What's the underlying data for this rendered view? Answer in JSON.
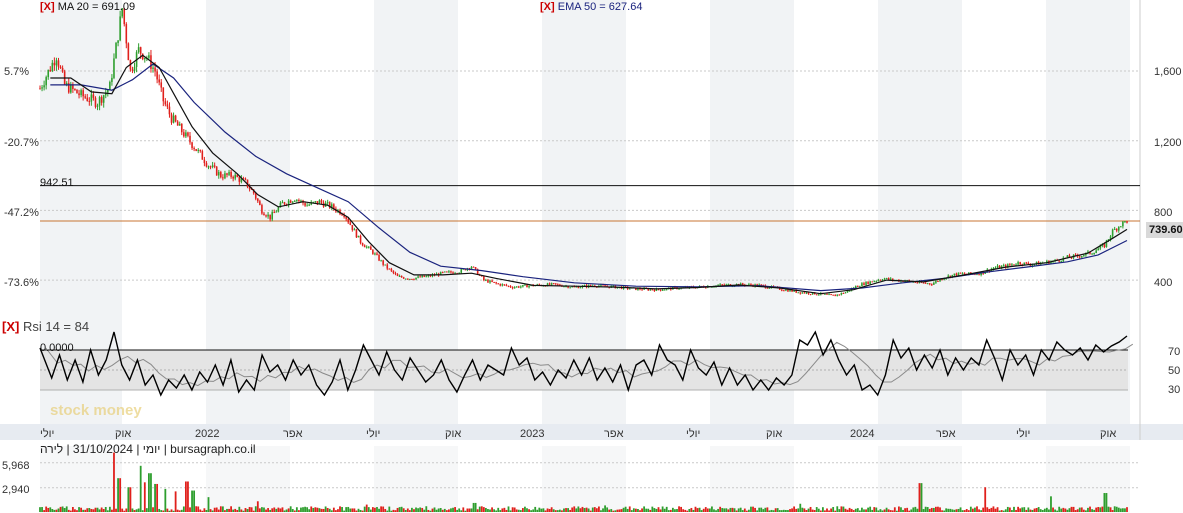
{
  "legends": {
    "ma_marker": "[X]",
    "ma_text": "MA 20 = 691.09",
    "ema_marker": "[X]",
    "ema_text": "EMA 50 = 627.64",
    "rsi_marker": "[X]",
    "rsi_text": "Rsi 14 = 84"
  },
  "source_line": "יומי | 31/10/2024 | לירה | bursagraph.co.il",
  "watermark": "stock money",
  "last_price_tag": "739.60",
  "colors": {
    "up": "#2e9e2e",
    "down": "#e0201c",
    "ma": "#111111",
    "ema": "#1a237e",
    "hline": "#c87533"
  },
  "chart_data": [
    {
      "type": "candlestick",
      "x_labels": [
        "יולי",
        "אוק",
        "2022",
        "אפר",
        "יולי",
        "אוק",
        "2023",
        "אפר",
        "יולי",
        "אוק",
        "2024",
        "אפר",
        "יולי",
        "אוק"
      ],
      "y_right_ticks": [
        "1,600",
        "1,200",
        "800",
        "400"
      ],
      "y_right_values": [
        1600,
        1200,
        800,
        400
      ],
      "y_left_ticks": [
        "5.7%",
        "-20.7%",
        "-47.2%",
        "-73.6%"
      ],
      "y_left_values": [
        1600,
        1200,
        800,
        400
      ],
      "ylim": [
        200,
        1950
      ],
      "reference_line": {
        "label": "942.51",
        "value": 942.51
      },
      "last_price_line": 739.6,
      "close_path": [
        [
          0,
          1500
        ],
        [
          8,
          1690
        ],
        [
          12,
          1520
        ],
        [
          20,
          1460
        ],
        [
          28,
          1420
        ],
        [
          34,
          1510
        ],
        [
          40,
          1960
        ],
        [
          44,
          1600
        ],
        [
          48,
          1720
        ],
        [
          52,
          1680
        ],
        [
          56,
          1600
        ],
        [
          60,
          1430
        ],
        [
          64,
          1330
        ],
        [
          70,
          1240
        ],
        [
          76,
          1150
        ],
        [
          82,
          1060
        ],
        [
          88,
          1000
        ],
        [
          94,
          1000
        ],
        [
          100,
          960
        ],
        [
          104,
          900
        ],
        [
          108,
          800
        ],
        [
          112,
          760
        ],
        [
          118,
          840
        ],
        [
          124,
          870
        ],
        [
          130,
          830
        ],
        [
          136,
          850
        ],
        [
          142,
          820
        ],
        [
          148,
          780
        ],
        [
          152,
          700
        ],
        [
          156,
          620
        ],
        [
          162,
          560
        ],
        [
          168,
          480
        ],
        [
          174,
          420
        ],
        [
          180,
          410
        ],
        [
          188,
          420
        ],
        [
          196,
          440
        ],
        [
          204,
          450
        ],
        [
          210,
          480
        ],
        [
          216,
          400
        ],
        [
          222,
          380
        ],
        [
          230,
          360
        ],
        [
          240,
          370
        ],
        [
          250,
          375
        ],
        [
          260,
          360
        ],
        [
          270,
          370
        ],
        [
          280,
          360
        ],
        [
          290,
          350
        ],
        [
          300,
          345
        ],
        [
          310,
          355
        ],
        [
          320,
          360
        ],
        [
          330,
          370
        ],
        [
          340,
          375
        ],
        [
          350,
          370
        ],
        [
          360,
          350
        ],
        [
          370,
          330
        ],
        [
          380,
          320
        ],
        [
          386,
          310
        ],
        [
          392,
          330
        ],
        [
          398,
          370
        ],
        [
          404,
          390
        ],
        [
          410,
          410
        ],
        [
          416,
          400
        ],
        [
          422,
          395
        ],
        [
          428,
          385
        ],
        [
          434,
          380
        ],
        [
          440,
          415
        ],
        [
          446,
          435
        ],
        [
          452,
          435
        ],
        [
          458,
          440
        ],
        [
          464,
          470
        ],
        [
          470,
          480
        ],
        [
          476,
          500
        ],
        [
          482,
          490
        ],
        [
          488,
          500
        ],
        [
          494,
          510
        ],
        [
          500,
          530
        ],
        [
          506,
          540
        ],
        [
          512,
          560
        ],
        [
          518,
          600
        ],
        [
          522,
          680
        ],
        [
          526,
          720
        ],
        [
          529,
          739.6
        ]
      ],
      "ma_path": [
        [
          5,
          1560
        ],
        [
          15,
          1560
        ],
        [
          25,
          1480
        ],
        [
          35,
          1470
        ],
        [
          42,
          1620
        ],
        [
          50,
          1690
        ],
        [
          58,
          1620
        ],
        [
          66,
          1450
        ],
        [
          74,
          1280
        ],
        [
          84,
          1130
        ],
        [
          96,
          1010
        ],
        [
          106,
          890
        ],
        [
          116,
          820
        ],
        [
          128,
          850
        ],
        [
          140,
          830
        ],
        [
          150,
          760
        ],
        [
          160,
          620
        ],
        [
          170,
          500
        ],
        [
          182,
          430
        ],
        [
          196,
          430
        ],
        [
          210,
          440
        ],
        [
          222,
          410
        ],
        [
          240,
          370
        ],
        [
          260,
          365
        ],
        [
          280,
          360
        ],
        [
          300,
          350
        ],
        [
          320,
          358
        ],
        [
          340,
          372
        ],
        [
          360,
          355
        ],
        [
          380,
          322
        ],
        [
          396,
          345
        ],
        [
          412,
          400
        ],
        [
          430,
          390
        ],
        [
          450,
          430
        ],
        [
          470,
          475
        ],
        [
          490,
          500
        ],
        [
          510,
          555
        ],
        [
          522,
          640
        ],
        [
          529,
          691.09
        ]
      ],
      "ema_path": [
        [
          5,
          1520
        ],
        [
          20,
          1520
        ],
        [
          35,
          1490
        ],
        [
          45,
          1550
        ],
        [
          55,
          1640
        ],
        [
          65,
          1560
        ],
        [
          75,
          1420
        ],
        [
          90,
          1250
        ],
        [
          105,
          1110
        ],
        [
          120,
          1010
        ],
        [
          135,
          930
        ],
        [
          150,
          850
        ],
        [
          165,
          700
        ],
        [
          180,
          560
        ],
        [
          195,
          480
        ],
        [
          215,
          455
        ],
        [
          235,
          420
        ],
        [
          260,
          385
        ],
        [
          290,
          365
        ],
        [
          320,
          362
        ],
        [
          350,
          368
        ],
        [
          380,
          340
        ],
        [
          400,
          355
        ],
        [
          420,
          385
        ],
        [
          440,
          410
        ],
        [
          460,
          445
        ],
        [
          480,
          475
        ],
        [
          500,
          505
        ],
        [
          515,
          545
        ],
        [
          529,
          627.64
        ]
      ]
    },
    {
      "type": "line",
      "title": "Rsi 14",
      "y_ticks": [
        "70",
        "50",
        "30"
      ],
      "y_values": [
        70,
        50,
        30
      ],
      "ylim": [
        0,
        100
      ],
      "upper_label": "0.0000",
      "last_value": 84,
      "rsi_path": [
        [
          0,
          72
        ],
        [
          6,
          42
        ],
        [
          10,
          65
        ],
        [
          14,
          40
        ],
        [
          18,
          60
        ],
        [
          22,
          38
        ],
        [
          26,
          70
        ],
        [
          30,
          45
        ],
        [
          34,
          60
        ],
        [
          38,
          88
        ],
        [
          42,
          55
        ],
        [
          46,
          40
        ],
        [
          50,
          60
        ],
        [
          54,
          35
        ],
        [
          58,
          45
        ],
        [
          62,
          25
        ],
        [
          66,
          40
        ],
        [
          70,
          32
        ],
        [
          74,
          45
        ],
        [
          78,
          30
        ],
        [
          82,
          48
        ],
        [
          86,
          38
        ],
        [
          90,
          55
        ],
        [
          94,
          35
        ],
        [
          98,
          60
        ],
        [
          102,
          28
        ],
        [
          106,
          40
        ],
        [
          110,
          30
        ],
        [
          114,
          65
        ],
        [
          118,
          48
        ],
        [
          122,
          55
        ],
        [
          126,
          40
        ],
        [
          130,
          60
        ],
        [
          134,
          45
        ],
        [
          138,
          55
        ],
        [
          142,
          35
        ],
        [
          146,
          25
        ],
        [
          150,
          38
        ],
        [
          154,
          60
        ],
        [
          158,
          30
        ],
        [
          162,
          50
        ],
        [
          166,
          75
        ],
        [
          170,
          60
        ],
        [
          174,
          45
        ],
        [
          178,
          68
        ],
        [
          182,
          50
        ],
        [
          186,
          40
        ],
        [
          190,
          62
        ],
        [
          194,
          50
        ],
        [
          198,
          38
        ],
        [
          202,
          45
        ],
        [
          206,
          60
        ],
        [
          210,
          40
        ],
        [
          214,
          28
        ],
        [
          218,
          45
        ],
        [
          222,
          60
        ],
        [
          226,
          40
        ],
        [
          230,
          55
        ],
        [
          234,
          50
        ],
        [
          238,
          45
        ],
        [
          242,
          72
        ],
        [
          246,
          55
        ],
        [
          250,
          62
        ],
        [
          254,
          40
        ],
        [
          258,
          48
        ],
        [
          262,
          35
        ],
        [
          266,
          50
        ],
        [
          270,
          42
        ],
        [
          274,
          60
        ],
        [
          278,
          45
        ],
        [
          282,
          62
        ],
        [
          286,
          40
        ],
        [
          290,
          52
        ],
        [
          294,
          38
        ],
        [
          298,
          55
        ],
        [
          302,
          30
        ],
        [
          306,
          55
        ],
        [
          310,
          60
        ],
        [
          314,
          45
        ],
        [
          318,
          75
        ],
        [
          322,
          60
        ],
        [
          326,
          55
        ],
        [
          330,
          40
        ],
        [
          334,
          70
        ],
        [
          338,
          52
        ],
        [
          342,
          45
        ],
        [
          346,
          58
        ],
        [
          350,
          35
        ],
        [
          354,
          52
        ],
        [
          358,
          35
        ],
        [
          362,
          45
        ],
        [
          366,
          30
        ],
        [
          370,
          40
        ],
        [
          374,
          30
        ],
        [
          378,
          42
        ],
        [
          382,
          35
        ],
        [
          386,
          45
        ],
        [
          390,
          80
        ],
        [
          394,
          75
        ],
        [
          398,
          88
        ],
        [
          402,
          65
        ],
        [
          406,
          80
        ],
        [
          410,
          60
        ],
        [
          414,
          45
        ],
        [
          418,
          55
        ],
        [
          422,
          30
        ],
        [
          426,
          35
        ],
        [
          430,
          25
        ],
        [
          434,
          45
        ],
        [
          438,
          80
        ],
        [
          442,
          62
        ],
        [
          446,
          72
        ],
        [
          450,
          50
        ],
        [
          454,
          65
        ],
        [
          458,
          52
        ],
        [
          462,
          70
        ],
        [
          466,
          45
        ],
        [
          470,
          62
        ],
        [
          474,
          50
        ],
        [
          478,
          62
        ],
        [
          482,
          55
        ],
        [
          486,
          80
        ],
        [
          490,
          62
        ],
        [
          494,
          40
        ],
        [
          498,
          70
        ],
        [
          502,
          55
        ],
        [
          506,
          65
        ],
        [
          510,
          45
        ],
        [
          514,
          70
        ],
        [
          518,
          60
        ],
        [
          522,
          78
        ],
        [
          526,
          70
        ],
        [
          530,
          65
        ],
        [
          534,
          72
        ],
        [
          538,
          60
        ],
        [
          542,
          75
        ],
        [
          546,
          68
        ],
        [
          550,
          74
        ],
        [
          554,
          78
        ],
        [
          558,
          84
        ]
      ]
    },
    {
      "type": "bar",
      "title": "Volume",
      "y_ticks": [
        "5,968",
        "2,940"
      ],
      "y_values": [
        5968,
        2940
      ],
      "ylim": [
        0,
        8000
      ],
      "spikes": [
        [
          0.068,
          7200
        ],
        [
          0.073,
          4100
        ],
        [
          0.082,
          3000
        ],
        [
          0.092,
          5600
        ],
        [
          0.096,
          3600
        ],
        [
          0.101,
          4700
        ],
        [
          0.107,
          3400
        ],
        [
          0.115,
          2800
        ],
        [
          0.125,
          2500
        ],
        [
          0.135,
          3700
        ],
        [
          0.141,
          2600
        ],
        [
          0.155,
          1800
        ],
        [
          0.2,
          1300
        ],
        [
          0.3,
          900
        ],
        [
          0.4,
          1100
        ],
        [
          0.52,
          800
        ],
        [
          0.7,
          1000
        ],
        [
          0.81,
          3500
        ],
        [
          0.87,
          3000
        ],
        [
          0.93,
          1900
        ],
        [
          0.98,
          2300
        ]
      ]
    }
  ]
}
